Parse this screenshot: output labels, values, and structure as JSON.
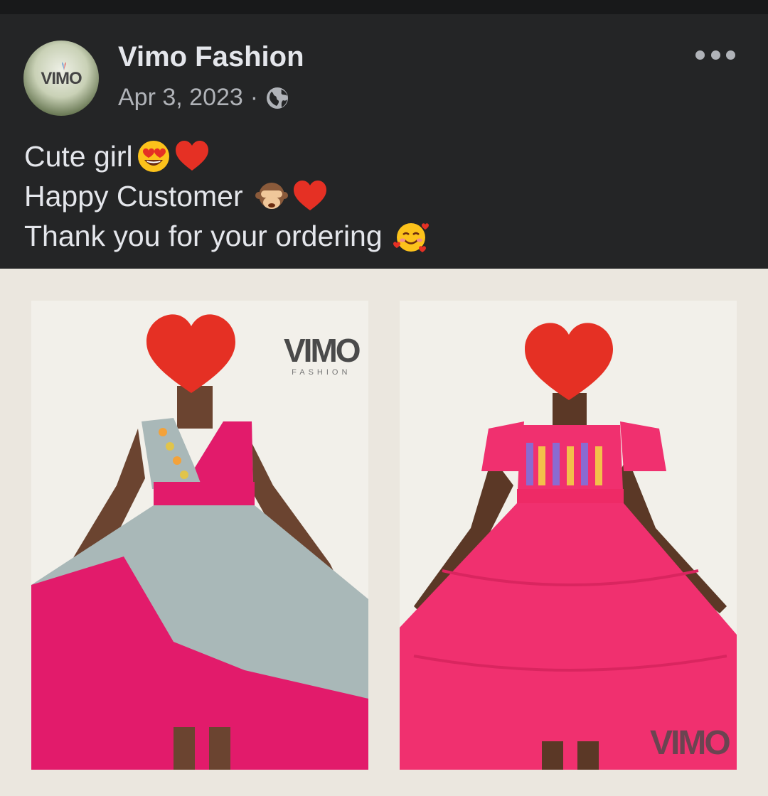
{
  "post": {
    "author": "Vimo Fashion",
    "date": "Apr 3, 2023",
    "separator": "·",
    "audience_icon": "globe-icon",
    "more_icon": "more-options-icon",
    "avatar_text": "VIMO",
    "caption_lines": [
      {
        "text": "Cute girl",
        "emojis": [
          "heart-eyes-emoji",
          "red-heart-emoji"
        ]
      },
      {
        "text": "Happy Customer ",
        "emojis": [
          "see-no-evil-monkey-emoji",
          "red-heart-emoji"
        ]
      },
      {
        "text": "Thank you for your ordering ",
        "emojis": [
          "smiling-face-with-hearts-emoji"
        ]
      }
    ]
  },
  "photos": [
    {
      "watermark": "VIMO",
      "watermark_sub": "FASHION",
      "dress_colors": [
        "#e21b6b",
        "#a9b8b8"
      ]
    },
    {
      "watermark": "VIMO",
      "dress_colors": [
        "#f0306f"
      ]
    }
  ],
  "colors": {
    "background": "#242526",
    "text": "#e4e6eb",
    "secondary_text": "#b0b3b8",
    "heart": "#e53024"
  }
}
